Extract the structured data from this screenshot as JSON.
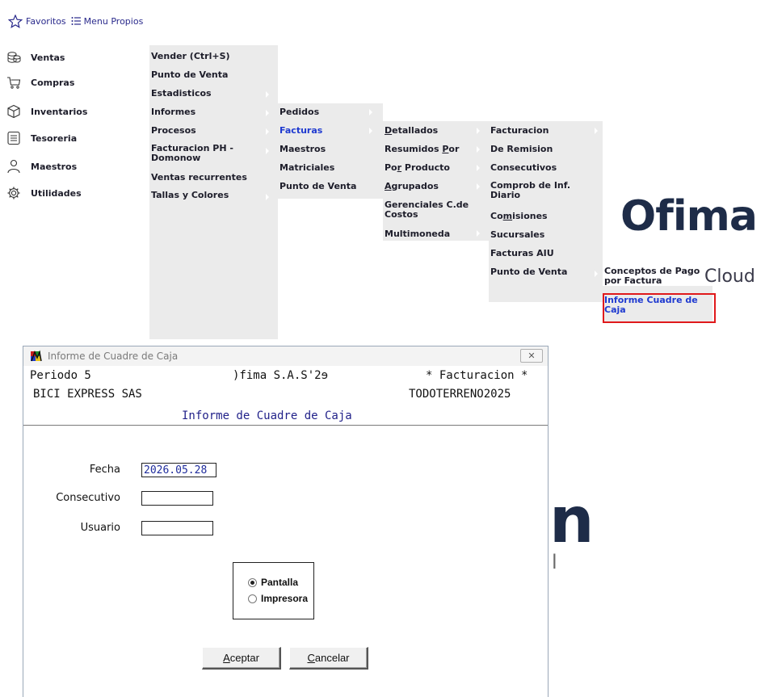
{
  "topbar": {
    "favoritos": "Favoritos",
    "menu_propios": "Menu Propios"
  },
  "main_menu": [
    {
      "label": "Ventas",
      "icon": "coins-icon"
    },
    {
      "label": "Compras",
      "icon": "cart-icon"
    },
    {
      "label": "Inventarios",
      "icon": "box-icon"
    },
    {
      "label": "Tesoreria",
      "icon": "list-icon"
    },
    {
      "label": "Maestros",
      "icon": "person-icon"
    },
    {
      "label": "Utilidades",
      "icon": "gear-icon"
    }
  ],
  "ventas_menu": {
    "vender": "Vender (Ctrl+S)",
    "punto_venta": "Punto de Venta",
    "estadisticos": "Estadisticos",
    "informes": "Informes",
    "procesos": "Procesos",
    "facturacion_ph": "Facturacion PH -",
    "facturacion_ph_2": "Domonow",
    "ventas_recurrentes": "Ventas recurrentes",
    "tallas": "Tallas y Colores"
  },
  "informes_menu": {
    "pedidos": "Pedidos",
    "facturas": "Facturas",
    "maestros": "Maestros",
    "matriciales": "Matriciales",
    "punto_venta": "Punto de Venta"
  },
  "facturas_menu": {
    "detallados_u": "D",
    "detallados_rest": "etallados",
    "resumidos_a": "Resumidos ",
    "resumidos_u": "P",
    "resumidos_b": "or",
    "por_u": "Po",
    "por_u2": "r",
    "por_rest": " Producto",
    "agrupados_u": "A",
    "agrupados_rest": "grupados",
    "gerenciales_1": "Gerenciales C.de",
    "gerenciales_2": "Costos",
    "multimoneda": "Multimoneda"
  },
  "facturacion_menu": {
    "facturacion": "Facturacion",
    "de_remision": "De Remision",
    "consecutivos": "Consecutivos",
    "comprob_1": "Comprob de Inf.",
    "comprob_2": "Diario",
    "comisiones_a": "Co",
    "comisiones_u": "m",
    "comisiones_b": "isiones",
    "sucursales": "Sucursales",
    "facturas_aiu": "Facturas AIU",
    "punto_venta": "Punto de Venta"
  },
  "pv_menu": {
    "conceptos_1": "Conceptos de Pago",
    "conceptos_2": "por Factura",
    "informe_1": "Informe Cuadre de",
    "informe_2": "Caja"
  },
  "logo": {
    "name": "Ofima",
    "sub": "Cloud"
  },
  "dialog": {
    "title": "Informe de Cuadre de Caja",
    "close": "✕",
    "periodo": "Periodo  5",
    "company": ")fima S.A.S'2ɘ",
    "module": "* Facturacion *",
    "client": "BICI EXPRESS SAS",
    "user_code": "TODOTERRENO2025",
    "heading": "Informe de Cuadre de Caja",
    "fields": {
      "fecha_label": "Fecha",
      "fecha_value": "2026.05.28",
      "consecutivo_label": "Consecutivo",
      "consecutivo_value": "",
      "usuario_label": "Usuario",
      "usuario_value": ""
    },
    "output": {
      "pantalla": "Pantalla",
      "impresora": "Impresora",
      "selected": "Pantalla"
    },
    "buttons": {
      "aceptar_u": "A",
      "aceptar_rest": "ceptar",
      "cancelar_u": "C",
      "cancelar_rest": "ancelar"
    }
  },
  "colors": {
    "menu_bg": "#ebebeb",
    "active_blue": "#1f3ad0",
    "highlight_red": "#e0191b",
    "logo_navy": "#1e2c48"
  }
}
